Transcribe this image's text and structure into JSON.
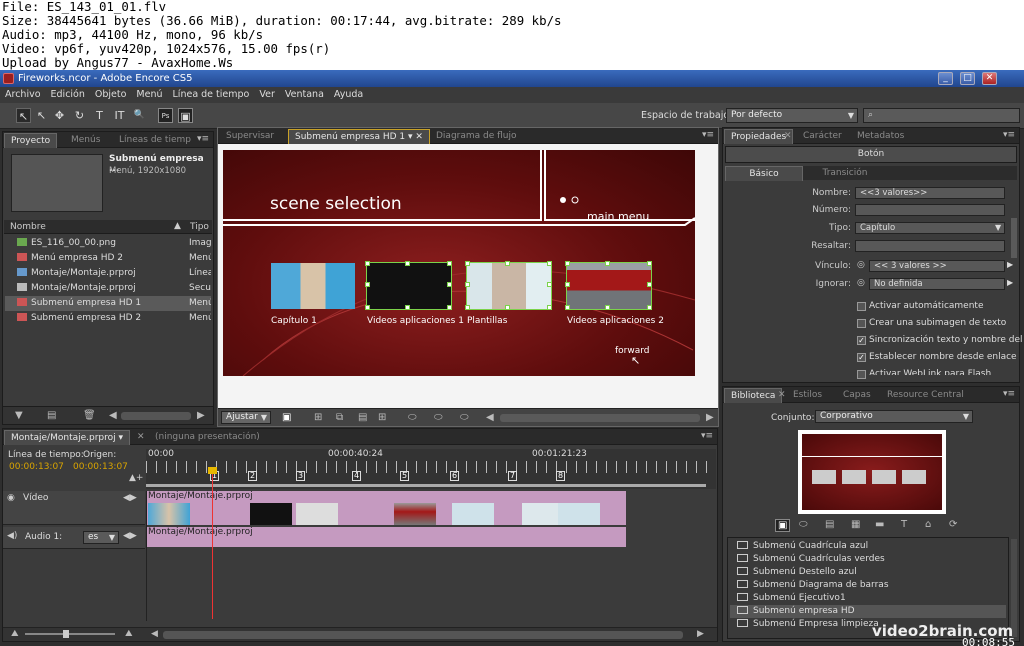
{
  "info_header": {
    "lines": [
      "File: ES_143_01_01.flv",
      "Size: 38445641 bytes (36.66 MiB), duration: 00:17:44, avg.bitrate: 289 kb/s",
      "Audio: mp3, 44100 Hz, mono, 96 kb/s",
      "Video: vp6f, yuv420p, 1024x576, 15.00 fps(r)",
      "Upload by Angus77 - AvaxHome.Ws"
    ]
  },
  "window": {
    "title": "Fireworks.ncor - Adobe Encore CS5",
    "minimize": "_",
    "maximize": "□",
    "close": "✕"
  },
  "menubar": [
    "Archivo",
    "Edición",
    "Objeto",
    "Menú",
    "Línea de tiempo",
    "Ver",
    "Ventana",
    "Ayuda"
  ],
  "toolbar": {
    "workspace_label": "Espacio de trabajo",
    "workspace_value": "Por defecto",
    "search_value": "",
    "tools": [
      "↖",
      "↖",
      "✥",
      "↻",
      "T",
      "IT",
      "🔍"
    ]
  },
  "project_panel": {
    "tabs": [
      "Proyecto",
      "Menús",
      "Líneas de tiemp"
    ],
    "preview_title": "Submenú empresa ...",
    "preview_sub": "Menú, 1920x1080",
    "col_name": "Nombre",
    "col_type": "Tipo",
    "items": [
      {
        "name": "ES_116_00_00.png",
        "type": "Imag",
        "color": "#6aa84f"
      },
      {
        "name": "Menú empresa HD 2",
        "type": "Menú",
        "color": "#c55"
      },
      {
        "name": "Montaje/Montaje.prproj",
        "type": "Línea",
        "color": "#69c"
      },
      {
        "name": "Montaje/Montaje.prproj",
        "type": "Secue",
        "color": "#bbb"
      },
      {
        "name": "Submenú empresa HD 1",
        "type": "Menú",
        "color": "#c55"
      },
      {
        "name": "Submenú empresa HD 2",
        "type": "Menú",
        "color": "#c55"
      }
    ]
  },
  "viewer": {
    "tabs": [
      "Supervisar",
      "Submenú empresa HD 1",
      "Diagrama de flujo"
    ],
    "menu_title": "scene selection",
    "main_menu": "main menu",
    "thumb_labels": [
      "Capítulo 1",
      "Videos aplicaciones 1",
      "Plantillas",
      "Videos aplicaciones 2"
    ],
    "forward": "forward",
    "zoom": "Ajustar"
  },
  "properties": {
    "tabs": [
      "Propiedades",
      "Carácter",
      "Metadatos"
    ],
    "header": "Botón",
    "subtabs": [
      "Básico",
      "Transición"
    ],
    "fields": [
      {
        "label": "Nombre:",
        "value": "<<3 valores>>"
      },
      {
        "label": "Número:",
        "value": ""
      },
      {
        "label": "Tipo:",
        "value": "Capítulo"
      },
      {
        "label": "Resaltar:",
        "value": ""
      },
      {
        "label": "Vínculo:",
        "value": "<< 3 valores >>"
      },
      {
        "label": "Ignorar:",
        "value": "No definida"
      }
    ],
    "checks": [
      {
        "label": "Activar automáticamente",
        "checked": false
      },
      {
        "label": "Crear una subimagen de texto",
        "checked": false
      },
      {
        "label": "Sincronización texto y nombre del",
        "checked": true
      },
      {
        "label": "Establecer nombre desde enlace",
        "checked": true
      },
      {
        "label": "Activar WebLink para Flash",
        "checked": false
      }
    ]
  },
  "timeline": {
    "tab": "Montaje/Montaje.prproj",
    "tab2": "(ninguna presentación)",
    "label_time": "Línea de tiempo:",
    "label_origin": "Origen:",
    "time_value": "00:00:13:07",
    "origin_value": "00:00:13:07",
    "ruler": [
      "00:00",
      "00:00:40:24",
      "00:01:21:23"
    ],
    "video_track": "Vídeo",
    "audio_track": "Audio 1:",
    "audio_lang": "es",
    "clip_name": "Montaje/Montaje.prproj",
    "audio_clip_name": "Montaje/Montaje.prproj",
    "markers": [
      "1",
      "2",
      "3",
      "4",
      "5",
      "6",
      "7",
      "8"
    ]
  },
  "library": {
    "tabs": [
      "Biblioteca",
      "Estilos",
      "Capas",
      "Resource Central"
    ],
    "set_label": "Conjunto:",
    "set_value": "Corporativo",
    "items": [
      {
        "name": "Submenú Cuadrícula azul",
        "sel": false
      },
      {
        "name": "Submenú Cuadrículas verdes",
        "sel": false
      },
      {
        "name": "Submenú Destello azul",
        "sel": false
      },
      {
        "name": "Submenú Diagrama de barras",
        "sel": false
      },
      {
        "name": "Submenú Ejecutivo1",
        "sel": false
      },
      {
        "name": "Submenú empresa HD",
        "sel": true
      },
      {
        "name": "Submenú Empresa limpieza",
        "sel": false
      }
    ]
  },
  "watermark": {
    "brand": "video2brain.com",
    "timecode": "00:08:55"
  }
}
